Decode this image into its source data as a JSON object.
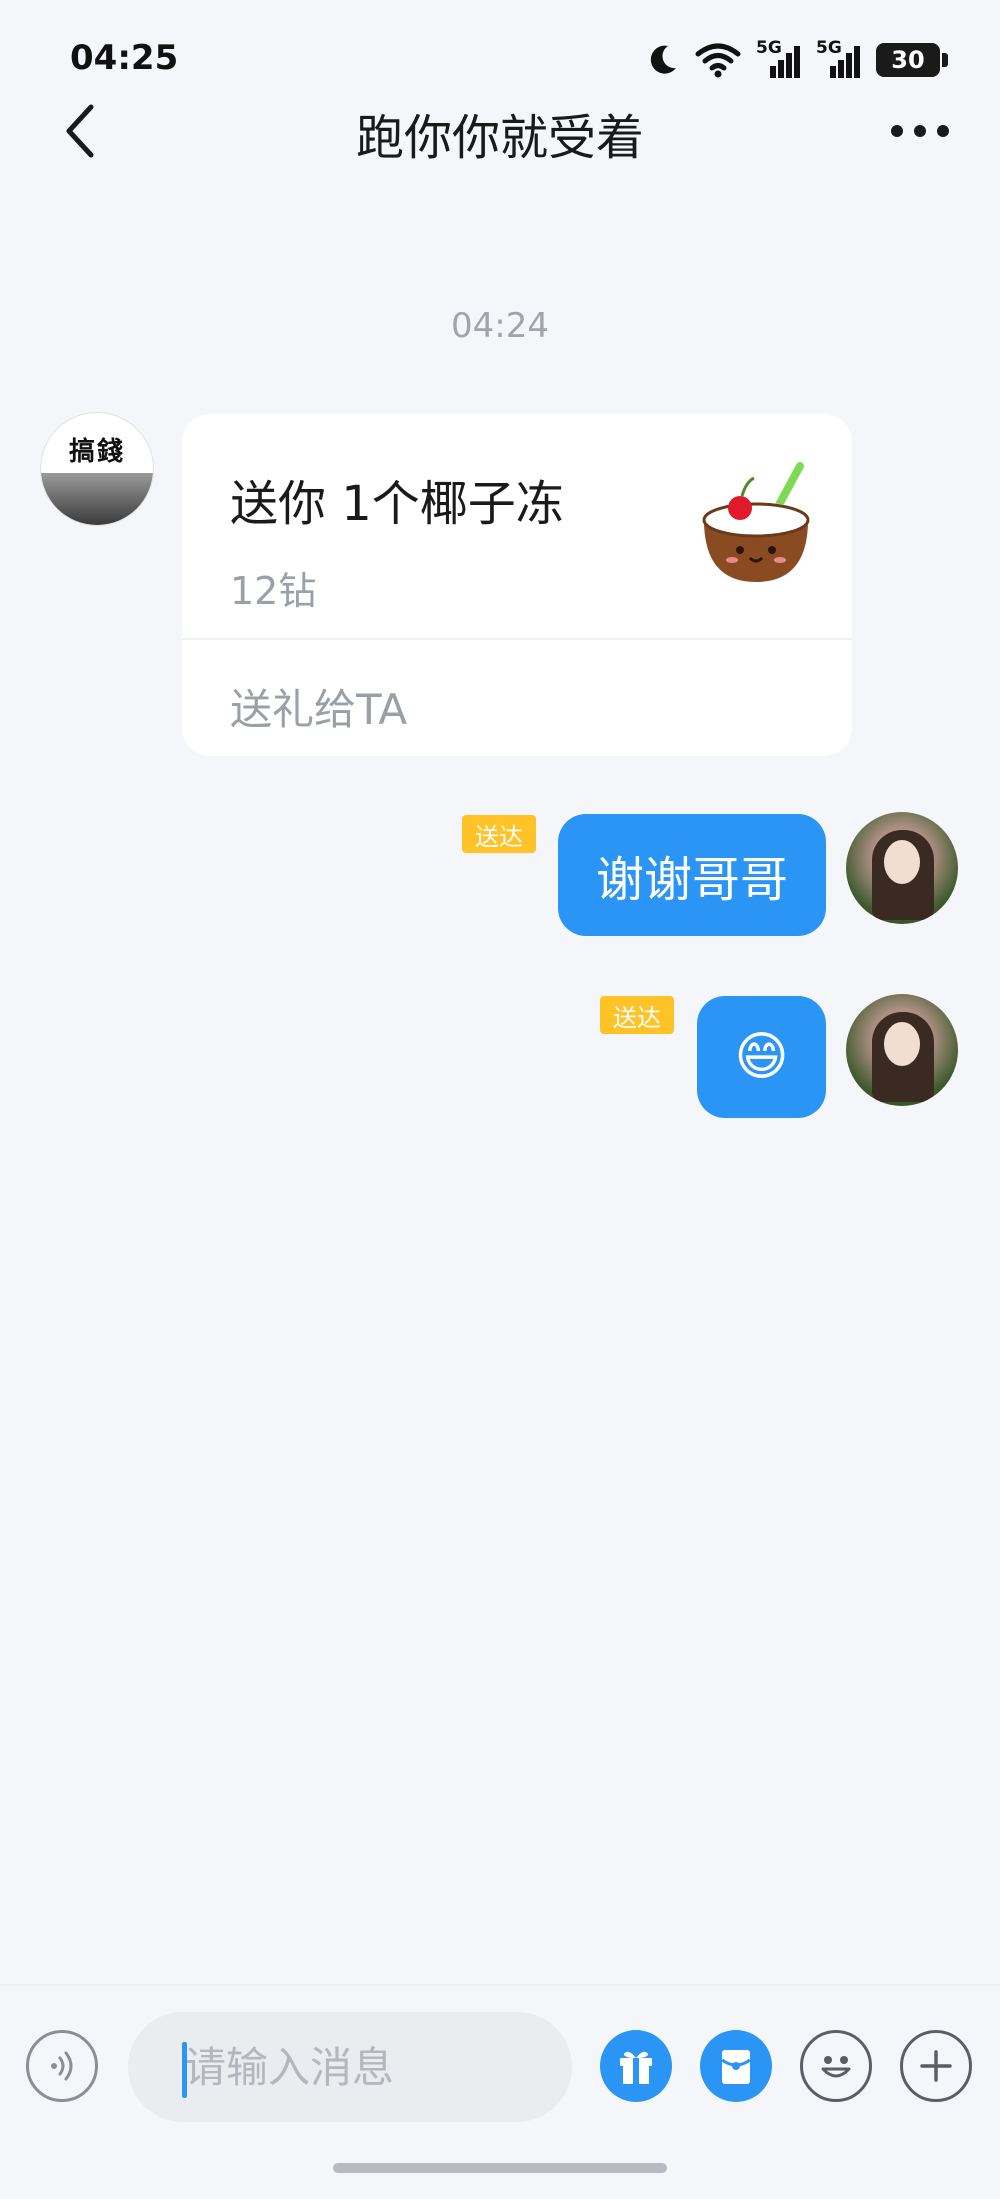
{
  "status_bar": {
    "time": "04:25",
    "signal_1_label": "5G",
    "signal_2_label": "5G",
    "battery": "30",
    "icons": [
      "moon-icon",
      "wifi-icon",
      "cellular-signal-icon",
      "cellular-signal-icon",
      "battery-icon"
    ]
  },
  "header": {
    "title": "跑你你就受着",
    "back_icon": "chevron-left-icon",
    "more_icon": "more-horizontal-icon"
  },
  "chat": {
    "timestamp": "04:24",
    "incoming_avatar_text": "搞錢",
    "gift_card": {
      "title": "送你 1个椰子冻",
      "price": "12钻",
      "action": "送礼给TA",
      "icon": "coconut-jelly-icon"
    },
    "outgoing": [
      {
        "text": "谢谢哥哥",
        "status": "送达"
      },
      {
        "emoji": "😄",
        "status": "送达"
      }
    ],
    "accent_color": "#2b95f5",
    "badge_color": "#ffc227"
  },
  "input_bar": {
    "placeholder": "请输入消息",
    "icons": [
      "voice-icon",
      "gift-icon",
      "red-packet-icon",
      "emoji-icon",
      "plus-icon"
    ]
  }
}
